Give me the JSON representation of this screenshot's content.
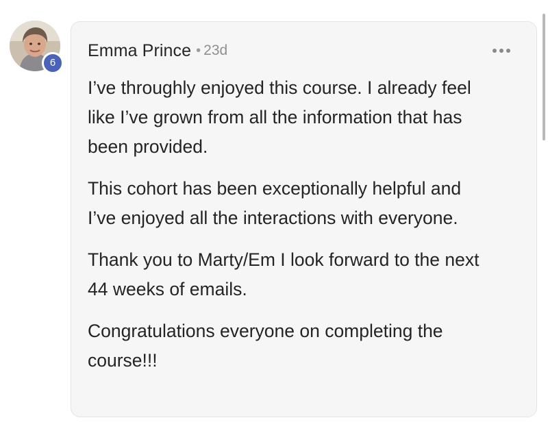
{
  "author": {
    "name": "Emma Prince",
    "separator": "•",
    "age": "23d",
    "level": "6"
  },
  "icons": {
    "avatar": "profile-photo",
    "menu": "more-horizontal-icon"
  },
  "colors": {
    "badge": "#4a62b7",
    "card_bg": "#f6f6f6",
    "text": "#242424",
    "meta": "#8f8f8f"
  },
  "post": {
    "paragraphs": [
      "I’ve throughly enjoyed this course. I already feel\nlike I’ve grown from all the information that has\nbeen provided.",
      "This cohort has been exceptionally helpful and\nI’ve enjoyed all the interactions with everyone.",
      "Thank you to Marty/Em I look forward to the next\n44 weeks of emails.",
      "Congratulations everyone on completing the\ncourse!!!"
    ]
  }
}
